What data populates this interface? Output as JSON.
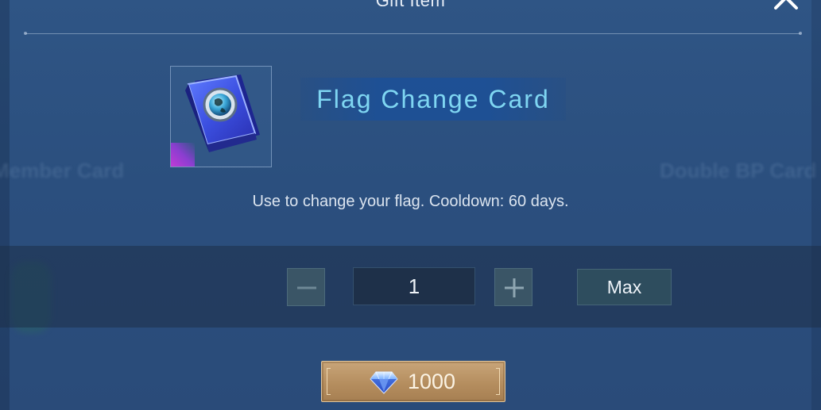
{
  "dialog": {
    "title": "Gift Item"
  },
  "background": {
    "left_item_label": "Member Card",
    "right_item_label": "Double BP Card"
  },
  "item": {
    "name": "Flag Change Card",
    "icon": "flag-change-card-icon",
    "rarity_color": "#c13bd6",
    "description": "Use to change your flag. Cooldown: 60 days."
  },
  "quantity": {
    "value": "1",
    "minus_icon": "minus-icon",
    "plus_icon": "plus-icon",
    "max_label": "Max"
  },
  "purchase": {
    "currency_icon": "diamond-icon",
    "price": "1000"
  },
  "colors": {
    "item_name": "#7fd6f2",
    "buy_button": "#c8a579"
  }
}
